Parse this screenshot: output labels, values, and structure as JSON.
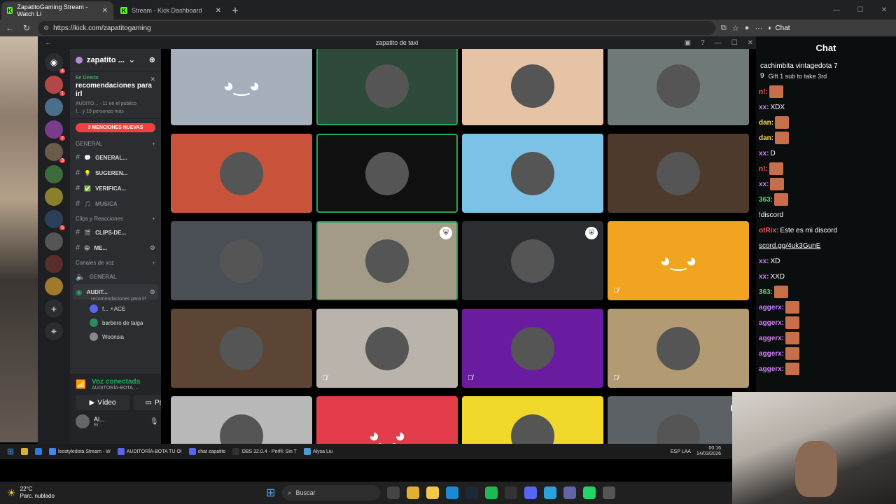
{
  "browser": {
    "tabs": [
      {
        "label": "ZapatitoGaming Stream - Watch Li",
        "active": true
      },
      {
        "label": "Stream - Kick Dashboard",
        "active": false
      }
    ],
    "url": "https://kick.com/zapatitogaming",
    "chat_button": "Chat"
  },
  "discord": {
    "window_title": "zapatito de taxi",
    "guild_name": "zapatito ...",
    "live": {
      "status": "En Directo",
      "title": "recomendaciones para irl",
      "channel": "AUDITO...",
      "viewers": "11 en el público",
      "more": "f... y 19 personas más"
    },
    "mentions_banner": "3 MENCIONES NUEVAS",
    "category_general": "GENERAL",
    "channels_general": [
      {
        "name": "GENERAL...",
        "emoji": "💬"
      },
      {
        "name": "SUGEREN...",
        "emoji": "💡"
      },
      {
        "name": "VERIFICA...",
        "emoji": "✅"
      },
      {
        "name": "MUSICA",
        "emoji": "🎵"
      }
    ],
    "category_clips": "Clips y Reacciones",
    "channels_clips": [
      {
        "name": "CLIPS-DE...",
        "emoji": "🎬"
      },
      {
        "name": "ME...",
        "emoji": "😁"
      }
    ],
    "category_voice": "Canales de voz",
    "voice_general": "GENERAL",
    "voice_active": "AUDIT...",
    "voice_active_sub": "recomendaciones para irl",
    "voice_users": [
      "f... ⚡ACE",
      "barbero de taiga",
      "Woonsia"
    ],
    "voice_panel": {
      "title": "Voz conectada",
      "channel": "AUDITORÍA-BOTA ...",
      "video": "Vídeo",
      "screen": "Pantall",
      "user": "Al...",
      "user_sub": "Er"
    },
    "tiles": [
      {
        "bg": "#a6b0bd",
        "type": "logo"
      },
      {
        "bg": "#2d4a3a",
        "type": "avatar",
        "speaking": true
      },
      {
        "bg": "#e6c3a5",
        "type": "avatar"
      },
      {
        "bg": "#6f7a78",
        "type": "avatar"
      },
      {
        "bg": "#c8533a",
        "type": "avatar"
      },
      {
        "bg": "#101010",
        "type": "avatar",
        "speaking": true
      },
      {
        "bg": "#7cc2e6",
        "type": "avatar"
      },
      {
        "bg": "#4d3a2c",
        "type": "avatar"
      },
      {
        "bg": "#4a4e55",
        "type": "avatar"
      },
      {
        "bg": "#a39a88",
        "type": "avatar",
        "speaking": true,
        "shield": true
      },
      {
        "bg": "#2b2d31",
        "type": "avatar",
        "shield": true
      },
      {
        "bg": "#f0a41f",
        "type": "logo",
        "muted": true
      },
      {
        "bg": "#5c4534",
        "type": "avatar"
      },
      {
        "bg": "#b9b3ac",
        "type": "avatar",
        "muted": true
      },
      {
        "bg": "#6a1ca0",
        "type": "avatar",
        "muted": true
      },
      {
        "bg": "#b29a72",
        "type": "avatar",
        "muted": true
      },
      {
        "bg": "#b9b9b9",
        "type": "avatar",
        "muted": true
      },
      {
        "bg": "#e23c4a",
        "type": "logo",
        "muted": true
      },
      {
        "bg": "#f0d92a",
        "type": "avatar",
        "muted": true
      },
      {
        "bg": "#5c6166",
        "type": "avatar",
        "muted": true,
        "shield": true
      }
    ]
  },
  "kick_chat": {
    "title": "Chat",
    "pinned_users": "cachimbita  vintagedota 7",
    "pinned_count": "9",
    "pinned_gift": "Gift 1 sub to take 3rd",
    "messages": [
      {
        "user": "n!:",
        "text": "",
        "emote": true,
        "color": "r"
      },
      {
        "user": "xx:",
        "text": "XDX",
        "emote": false,
        "color": ""
      },
      {
        "user": "dan:",
        "text": "",
        "emote": true,
        "color": "y"
      },
      {
        "user": "dan:",
        "text": "",
        "emote": true,
        "color": "y"
      },
      {
        "user": "xx:",
        "text": "D",
        "emote": false,
        "color": ""
      },
      {
        "user": "n!:",
        "text": "",
        "emote": true,
        "color": "r"
      },
      {
        "user": "xx:",
        "text": "",
        "emote": true,
        "color": ""
      },
      {
        "user": "363:",
        "text": "",
        "emote": true,
        "color": "g"
      },
      {
        "user": "",
        "text": "!discord",
        "emote": false,
        "color": ""
      },
      {
        "user": "otRix:",
        "text": "Este es mi discord",
        "emote": false,
        "color": "r"
      },
      {
        "user": "",
        "text": "scord.gg/4uk3GunE",
        "emote": false,
        "color": "",
        "link": true
      },
      {
        "user": "xx:",
        "text": "XD",
        "emote": false,
        "color": ""
      },
      {
        "user": "xx:",
        "text": "XXD",
        "emote": false,
        "color": ""
      },
      {
        "user": "363:",
        "text": "",
        "emote": true,
        "color": "g"
      },
      {
        "user": "aggerx:",
        "text": "",
        "emote": true,
        "color": ""
      },
      {
        "user": "aggerx:",
        "text": "",
        "emote": true,
        "color": ""
      },
      {
        "user": "aggerx:",
        "text": "",
        "emote": true,
        "color": ""
      },
      {
        "user": "aggerx:",
        "text": "",
        "emote": true,
        "color": ""
      },
      {
        "user": "aggerx:",
        "text": "",
        "emote": true,
        "color": ""
      }
    ]
  },
  "inner_taskbar": {
    "items": [
      "leostyledota Stream - W",
      "AUDITORÍA-BOTA TU OI",
      "chat zapatito",
      "OBS 32.0.4 - Perfil: Sin T",
      "Alysa Liu"
    ],
    "tray_lang": "ESP LAA",
    "time": "00:16",
    "date": "14/03/2026"
  },
  "outer_taskbar": {
    "temp": "22°C",
    "weather": "Parc. nublado",
    "search": "Buscar"
  }
}
